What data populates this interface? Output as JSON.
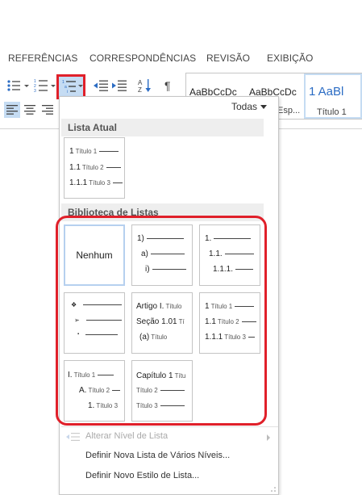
{
  "ribbon": {
    "tabs": [
      "REFERÊNCIAS",
      "CORRESPONDÊNCIAS",
      "REVISÃO",
      "EXIBIÇÃO"
    ],
    "styles": [
      {
        "sample": "AaBbCcDc",
        "name": ""
      },
      {
        "sample": "AaBbCcDc",
        "name": "Esp..."
      },
      {
        "sample": "1 AaBl",
        "name": "Título 1"
      }
    ]
  },
  "dropdown": {
    "filter_label": "Todas",
    "current_list_header": "Lista Atual",
    "current_list": {
      "lines": [
        {
          "num": "1",
          "label": "Título 1"
        },
        {
          "num": "1.1",
          "label": "Título 2"
        },
        {
          "num": "1.1.1",
          "label": "Título 3"
        }
      ]
    },
    "library_header": "Biblioteca de Listas",
    "library": {
      "none_label": "Nenhum",
      "numeric_parens": [
        "1)",
        "a)",
        "i)"
      ],
      "decimal": [
        "1.",
        "1.1.",
        "1.1.1."
      ],
      "bullets": [
        "❖",
        "➢",
        "▪"
      ],
      "article": [
        {
          "num": "Artigo I.",
          "label": "Título"
        },
        {
          "num": "Seção 1.01",
          "label": "Tí"
        },
        {
          "num": "(a)",
          "label": "Título"
        }
      ],
      "heading_numbered": [
        {
          "num": "1",
          "label": "Título 1"
        },
        {
          "num": "1.1",
          "label": "Título 2"
        },
        {
          "num": "1.1.1",
          "label": "Título 3"
        }
      ],
      "roman": [
        {
          "num": "I.",
          "label": "Título 1"
        },
        {
          "num": "A.",
          "label": "Título 2"
        },
        {
          "num": "1.",
          "label": "Título 3"
        }
      ],
      "chapter": [
        {
          "num": "Capítulo 1",
          "label": "Títu"
        },
        {
          "num": "",
          "label": "Título 2"
        },
        {
          "num": "",
          "label": "Título 3"
        }
      ]
    },
    "menu": {
      "change_level": "Alterar Nível de Lista",
      "define_multilevel": "Definir Nova Lista de Vários Níveis...",
      "define_style": "Definir Novo Estilo de Lista..."
    }
  },
  "colors": {
    "highlight_red": "#e0202a",
    "selected_blue": "#c5dcf3",
    "section_bg": "#eeeeee"
  }
}
